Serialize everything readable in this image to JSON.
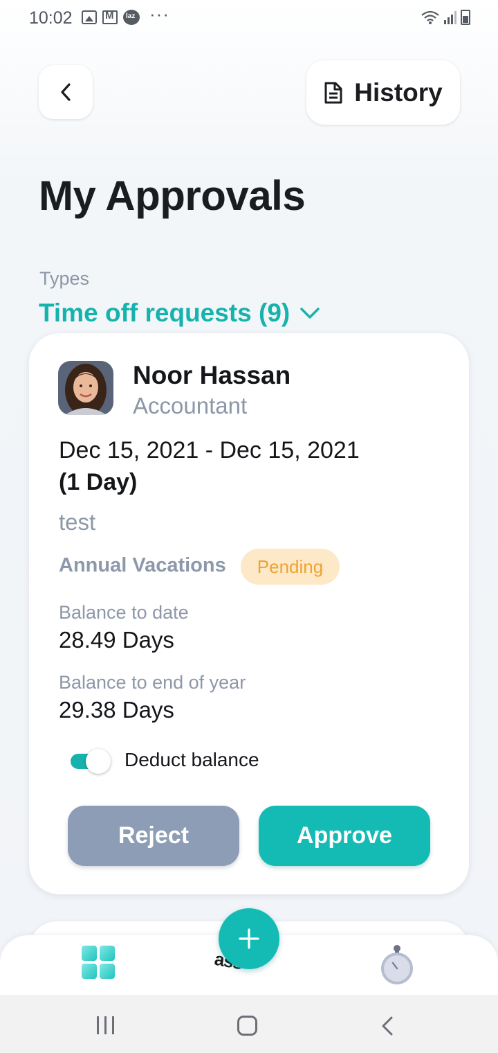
{
  "status_bar": {
    "time": "10:02",
    "icons_left": [
      "image-icon",
      "gmail-icon",
      "lazada-icon",
      "more-dots-icon"
    ],
    "icons_right": [
      "wifi-icon",
      "signal-icon",
      "battery-icon"
    ],
    "more": "···"
  },
  "header": {
    "back_icon": "chevron-left-icon",
    "history_icon": "document-icon",
    "history_label": "History"
  },
  "page_title": "My Approvals",
  "types": {
    "label": "Types",
    "value": "Time off requests (9)"
  },
  "request": {
    "name": "Noor Hassan",
    "role": "Accountant",
    "date_range": "Dec 15, 2021 - Dec 15, 2021",
    "duration": "(1 Day)",
    "note": "test",
    "leave_type": "Annual Vacations",
    "status": "Pending",
    "balance_to_date_label": "Balance to date",
    "balance_to_date_value": "28.49 Days",
    "balance_eoy_label": "Balance to end of year",
    "balance_eoy_value": "29.38 Days",
    "deduct_label": "Deduct balance",
    "deduct_on": true,
    "reject_label": "Reject",
    "approve_label": "Approve"
  },
  "colors": {
    "accent": "#14bbb5",
    "muted": "#8c97a8",
    "pending_bg": "#fde8c8",
    "pending_text": "#f0a32f",
    "reject_bg": "#8e9db6"
  },
  "tabbar": {
    "tabs": [
      "dashboard-icon",
      "tasks-tab",
      "timer-icon"
    ],
    "center_partial_text": "ass",
    "fab_icon": "plus-icon"
  }
}
